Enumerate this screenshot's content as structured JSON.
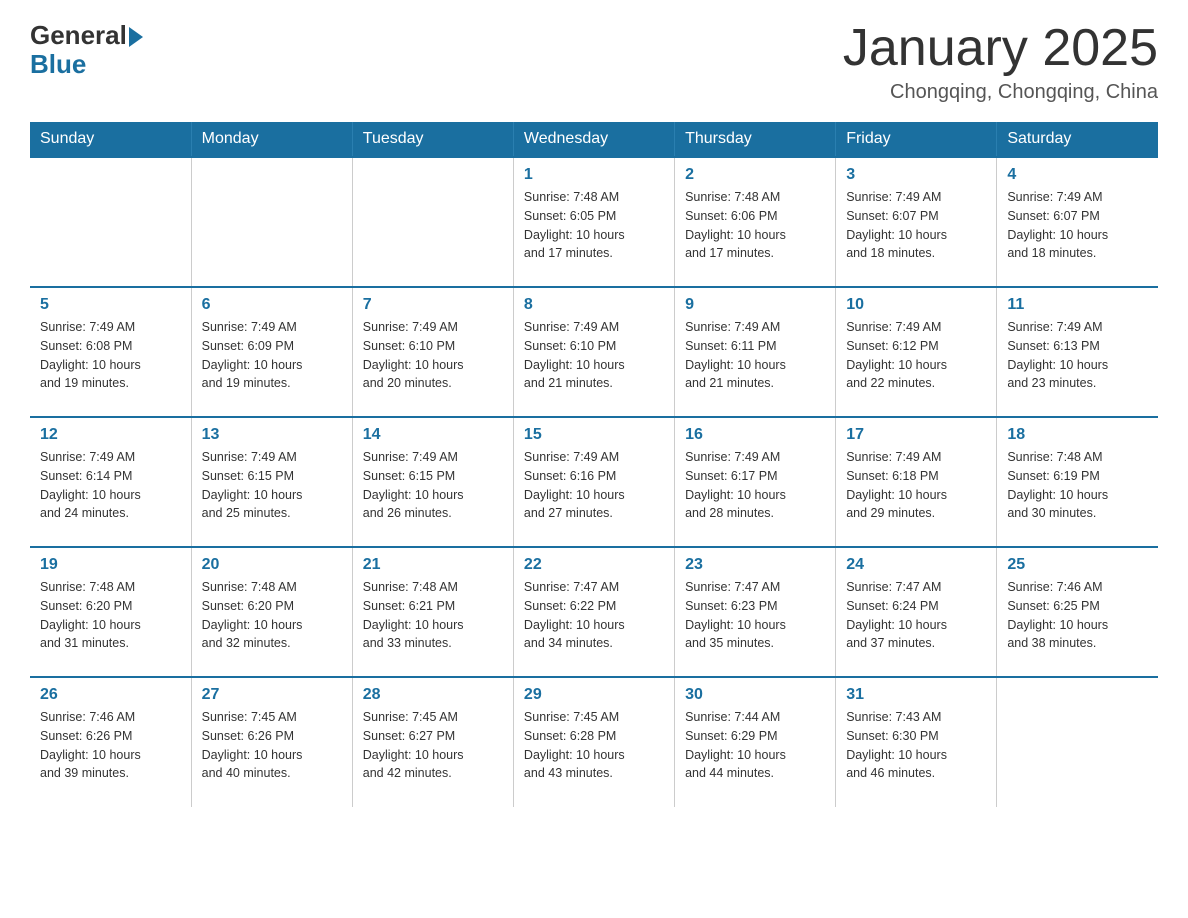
{
  "header": {
    "logo_general": "General",
    "logo_blue": "Blue",
    "title": "January 2025",
    "subtitle": "Chongqing, Chongqing, China"
  },
  "weekdays": [
    "Sunday",
    "Monday",
    "Tuesday",
    "Wednesday",
    "Thursday",
    "Friday",
    "Saturday"
  ],
  "weeks": [
    [
      {
        "day": "",
        "info": ""
      },
      {
        "day": "",
        "info": ""
      },
      {
        "day": "",
        "info": ""
      },
      {
        "day": "1",
        "info": "Sunrise: 7:48 AM\nSunset: 6:05 PM\nDaylight: 10 hours\nand 17 minutes."
      },
      {
        "day": "2",
        "info": "Sunrise: 7:48 AM\nSunset: 6:06 PM\nDaylight: 10 hours\nand 17 minutes."
      },
      {
        "day": "3",
        "info": "Sunrise: 7:49 AM\nSunset: 6:07 PM\nDaylight: 10 hours\nand 18 minutes."
      },
      {
        "day": "4",
        "info": "Sunrise: 7:49 AM\nSunset: 6:07 PM\nDaylight: 10 hours\nand 18 minutes."
      }
    ],
    [
      {
        "day": "5",
        "info": "Sunrise: 7:49 AM\nSunset: 6:08 PM\nDaylight: 10 hours\nand 19 minutes."
      },
      {
        "day": "6",
        "info": "Sunrise: 7:49 AM\nSunset: 6:09 PM\nDaylight: 10 hours\nand 19 minutes."
      },
      {
        "day": "7",
        "info": "Sunrise: 7:49 AM\nSunset: 6:10 PM\nDaylight: 10 hours\nand 20 minutes."
      },
      {
        "day": "8",
        "info": "Sunrise: 7:49 AM\nSunset: 6:10 PM\nDaylight: 10 hours\nand 21 minutes."
      },
      {
        "day": "9",
        "info": "Sunrise: 7:49 AM\nSunset: 6:11 PM\nDaylight: 10 hours\nand 21 minutes."
      },
      {
        "day": "10",
        "info": "Sunrise: 7:49 AM\nSunset: 6:12 PM\nDaylight: 10 hours\nand 22 minutes."
      },
      {
        "day": "11",
        "info": "Sunrise: 7:49 AM\nSunset: 6:13 PM\nDaylight: 10 hours\nand 23 minutes."
      }
    ],
    [
      {
        "day": "12",
        "info": "Sunrise: 7:49 AM\nSunset: 6:14 PM\nDaylight: 10 hours\nand 24 minutes."
      },
      {
        "day": "13",
        "info": "Sunrise: 7:49 AM\nSunset: 6:15 PM\nDaylight: 10 hours\nand 25 minutes."
      },
      {
        "day": "14",
        "info": "Sunrise: 7:49 AM\nSunset: 6:15 PM\nDaylight: 10 hours\nand 26 minutes."
      },
      {
        "day": "15",
        "info": "Sunrise: 7:49 AM\nSunset: 6:16 PM\nDaylight: 10 hours\nand 27 minutes."
      },
      {
        "day": "16",
        "info": "Sunrise: 7:49 AM\nSunset: 6:17 PM\nDaylight: 10 hours\nand 28 minutes."
      },
      {
        "day": "17",
        "info": "Sunrise: 7:49 AM\nSunset: 6:18 PM\nDaylight: 10 hours\nand 29 minutes."
      },
      {
        "day": "18",
        "info": "Sunrise: 7:48 AM\nSunset: 6:19 PM\nDaylight: 10 hours\nand 30 minutes."
      }
    ],
    [
      {
        "day": "19",
        "info": "Sunrise: 7:48 AM\nSunset: 6:20 PM\nDaylight: 10 hours\nand 31 minutes."
      },
      {
        "day": "20",
        "info": "Sunrise: 7:48 AM\nSunset: 6:20 PM\nDaylight: 10 hours\nand 32 minutes."
      },
      {
        "day": "21",
        "info": "Sunrise: 7:48 AM\nSunset: 6:21 PM\nDaylight: 10 hours\nand 33 minutes."
      },
      {
        "day": "22",
        "info": "Sunrise: 7:47 AM\nSunset: 6:22 PM\nDaylight: 10 hours\nand 34 minutes."
      },
      {
        "day": "23",
        "info": "Sunrise: 7:47 AM\nSunset: 6:23 PM\nDaylight: 10 hours\nand 35 minutes."
      },
      {
        "day": "24",
        "info": "Sunrise: 7:47 AM\nSunset: 6:24 PM\nDaylight: 10 hours\nand 37 minutes."
      },
      {
        "day": "25",
        "info": "Sunrise: 7:46 AM\nSunset: 6:25 PM\nDaylight: 10 hours\nand 38 minutes."
      }
    ],
    [
      {
        "day": "26",
        "info": "Sunrise: 7:46 AM\nSunset: 6:26 PM\nDaylight: 10 hours\nand 39 minutes."
      },
      {
        "day": "27",
        "info": "Sunrise: 7:45 AM\nSunset: 6:26 PM\nDaylight: 10 hours\nand 40 minutes."
      },
      {
        "day": "28",
        "info": "Sunrise: 7:45 AM\nSunset: 6:27 PM\nDaylight: 10 hours\nand 42 minutes."
      },
      {
        "day": "29",
        "info": "Sunrise: 7:45 AM\nSunset: 6:28 PM\nDaylight: 10 hours\nand 43 minutes."
      },
      {
        "day": "30",
        "info": "Sunrise: 7:44 AM\nSunset: 6:29 PM\nDaylight: 10 hours\nand 44 minutes."
      },
      {
        "day": "31",
        "info": "Sunrise: 7:43 AM\nSunset: 6:30 PM\nDaylight: 10 hours\nand 46 minutes."
      },
      {
        "day": "",
        "info": ""
      }
    ]
  ]
}
